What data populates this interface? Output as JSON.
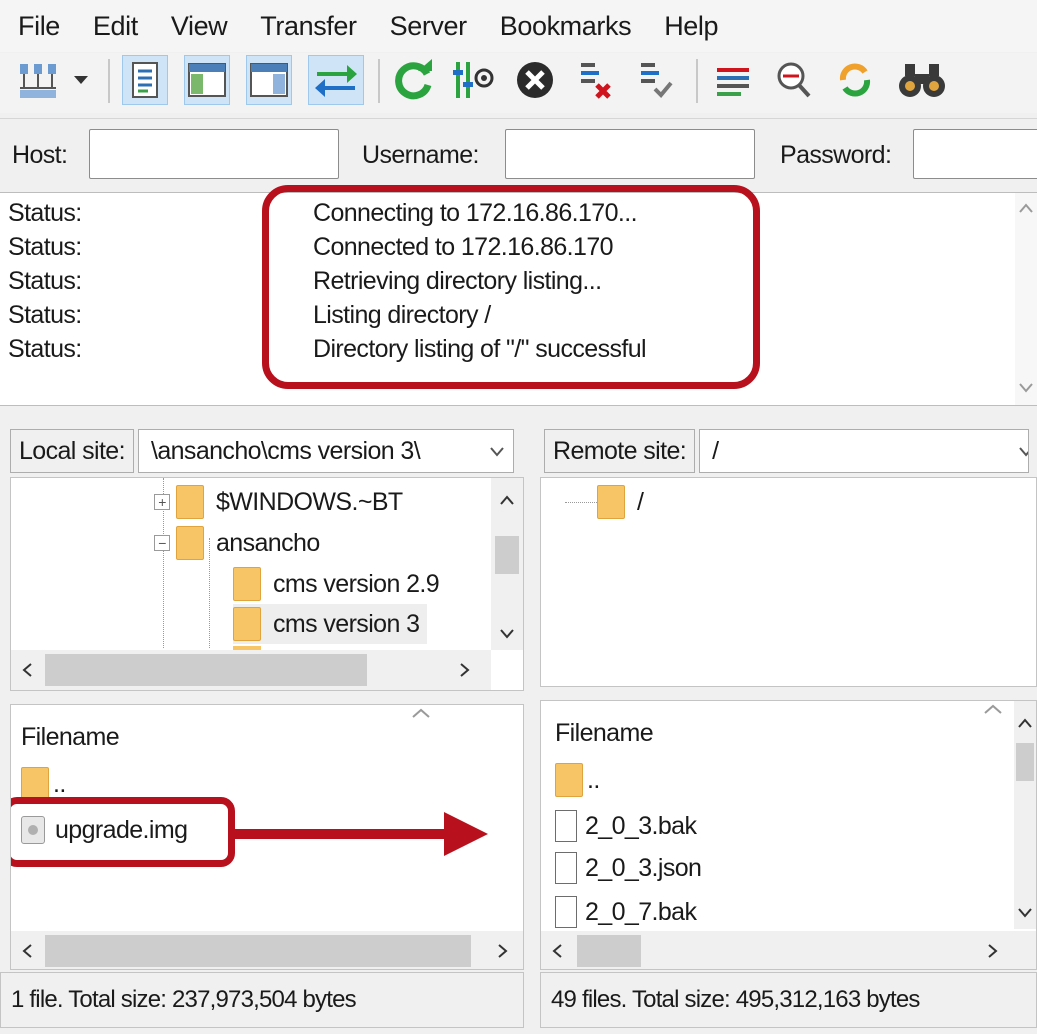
{
  "menu": [
    "File",
    "Edit",
    "View",
    "Transfer",
    "Server",
    "Bookmarks",
    "Help"
  ],
  "toolbar": {
    "icons": [
      "site-manager-icon",
      "dropdown-arrow-icon",
      "message-log-toggle-icon",
      "local-tree-toggle-icon",
      "remote-tree-toggle-icon",
      "transfer-queue-toggle-icon",
      "refresh-icon",
      "process-queue-icon",
      "cancel-icon",
      "disconnect-icon",
      "reconnect-icon",
      "directory-filter-icon",
      "search-files-icon",
      "sync-browsing-icon",
      "find-binoculars-icon"
    ]
  },
  "quickconnect": {
    "host_label": "Host:",
    "username_label": "Username:",
    "password_label": "Password:",
    "host_value": "",
    "username_value": "",
    "password_value": ""
  },
  "log": [
    {
      "label": "Status:",
      "message": "Connecting to 172.16.86.170..."
    },
    {
      "label": "Status:",
      "message": "Connected to 172.16.86.170"
    },
    {
      "label": "Status:",
      "message": "Retrieving directory listing..."
    },
    {
      "label": "Status:",
      "message": "Listing directory /"
    },
    {
      "label": "Status:",
      "message": "Directory listing of \"/\" successful"
    }
  ],
  "local": {
    "site_label": "Local site:",
    "path": "\\ansancho\\cms version 3\\",
    "tree": [
      "$WINDOWS.~BT",
      "ansancho",
      "cms version 2.9",
      "cms version 3"
    ],
    "filename_header": "Filename",
    "files": [
      "..",
      "upgrade.img"
    ],
    "status": "1 file. Total size: 237,973,504 bytes"
  },
  "remote": {
    "site_label": "Remote site:",
    "path": "/",
    "tree": [
      "/"
    ],
    "filename_header": "Filename",
    "files": [
      "..",
      "2_0_3.bak",
      "2_0_3.json",
      "2_0_7.bak"
    ],
    "status": "49 files. Total size: 495,312,163 bytes"
  },
  "colors": {
    "highlight": "#b8101c",
    "folder": "#f7c466",
    "toggle": "#cfe5f7"
  }
}
